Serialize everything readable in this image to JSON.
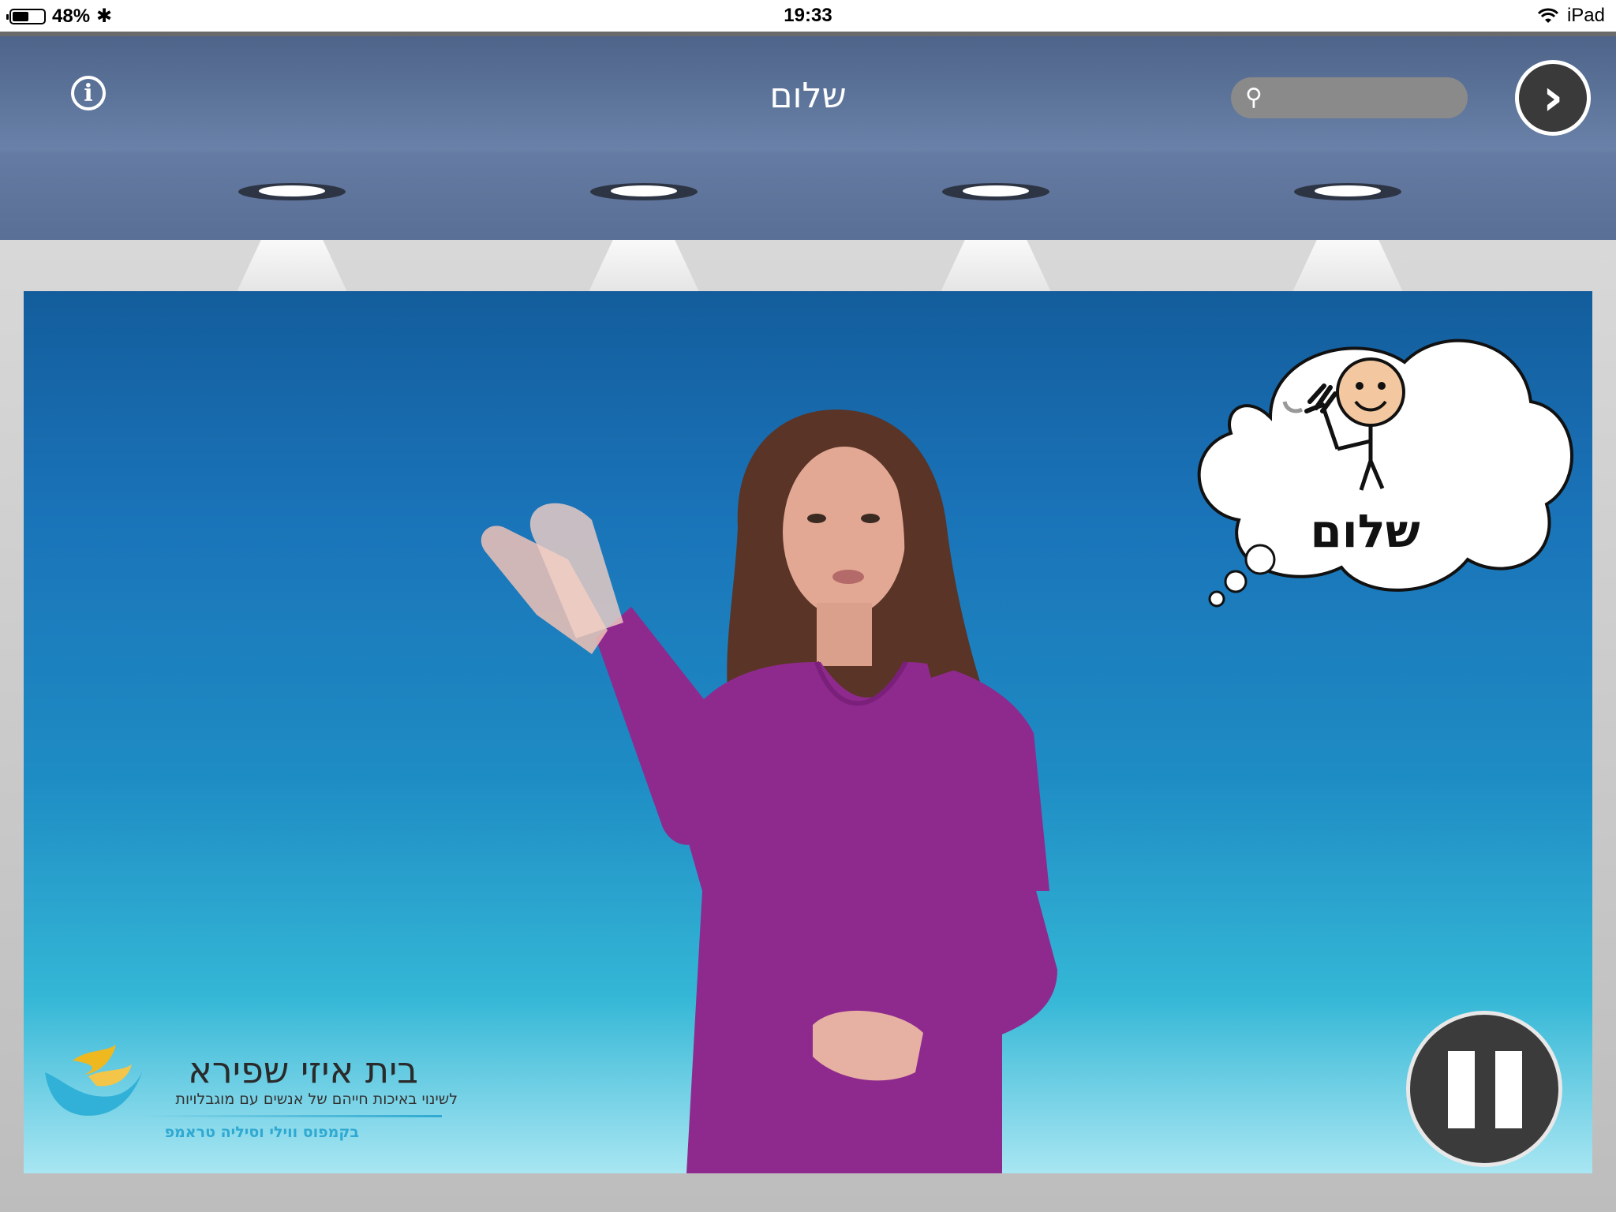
{
  "status_bar": {
    "battery": "48%",
    "time": "19:33",
    "device": "iPad"
  },
  "nav": {
    "title": "שלום",
    "search_placeholder": "",
    "info_icon": "info-icon",
    "next_icon": "chevron-right-icon"
  },
  "video": {
    "thought_word": "שלום",
    "logo_title": "בית איזי שפירא",
    "logo_subtitle": "לשינוי באיכות חייהם של אנשים עם מוגבלויות",
    "logo_subtitle2": "בקמפוס ווילי וסיליה טראמפ",
    "pause_icon": "pause-icon"
  },
  "colors": {
    "nav_top": "#4e6489",
    "nav_bottom": "#6a82a9",
    "video_top": "#135d9c",
    "video_bottom": "#a8e6f2",
    "shirt": "#8e2a8e"
  }
}
